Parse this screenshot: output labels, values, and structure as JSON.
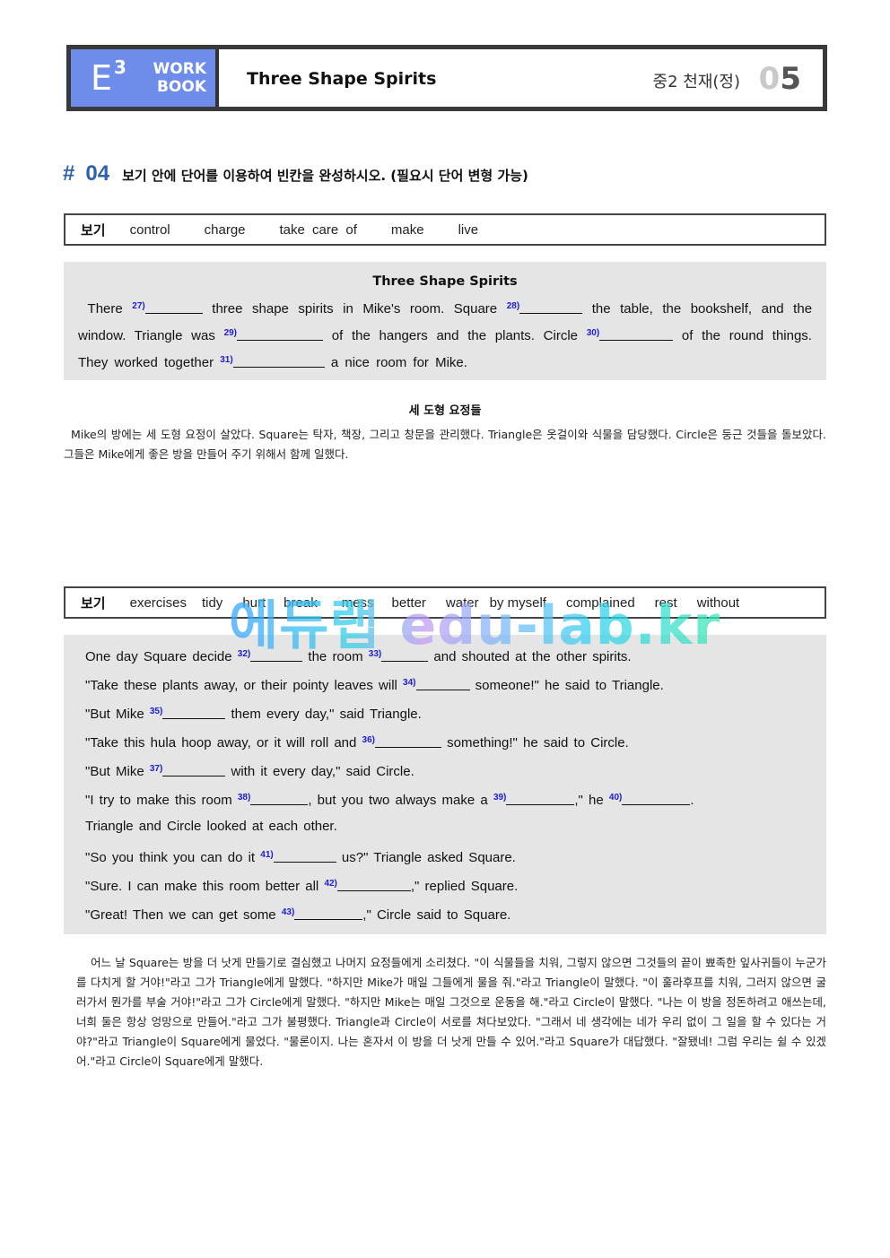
{
  "header": {
    "brand_letter": "E",
    "brand_sup": "3",
    "brand_line1": "WORK",
    "brand_line2": "BOOK",
    "title": "Three Shape Spirits",
    "grade": "중2 천재(정)",
    "unit_prefix": "0",
    "unit_suffix": "5"
  },
  "section": {
    "hash": "#",
    "number": "04",
    "instruction": "보기 안에 단어를 이용하여 빈칸을 완성하시오. (필요시 단어 변형 가능)"
  },
  "wordbox1": {
    "label": "보기",
    "words": [
      "control",
      "charge",
      "take care of",
      "make",
      "live"
    ]
  },
  "passage1": {
    "title": "Three Shape Spirits",
    "segments": {
      "s1": "There",
      "b27": "27)",
      "s2": "three shape spirits in Mike's room. Square",
      "b28": "28)",
      "s3": "the table, the bookshelf, and the window. Triangle was",
      "b29": "29)",
      "s4": "of the hangers and the plants. Circle",
      "b30": "30)",
      "s5": "of the round things. They worked together",
      "b31": "31)",
      "s6": "a nice room for Mike."
    }
  },
  "translation1": {
    "title": "세 도형 요정들",
    "text": "Mike의 방에는 세 도형 요정이 살았다. Square는 탁자, 책장, 그리고 창문을 관리했다. Triangle은 옷걸이와 식물을 담당했다. Circle은 둥근 것들을 돌보았다. 그들은 Mike에게 좋은 방을 만들어 주기 위해서 함께 일했다."
  },
  "wordbox2": {
    "label": "보기",
    "words": [
      "exercises",
      "tidy",
      "hurt",
      "break",
      "mess",
      "better",
      "water",
      "by myself",
      "complained",
      "rest",
      "without"
    ]
  },
  "watermark": "에듀랩 edu-lab.kr",
  "passage2": {
    "lines": [
      {
        "a": "One day Square decide",
        "n1": "32)",
        "b": "the room",
        "n2": "33)",
        "c": "and shouted at the other spirits."
      },
      {
        "a": "\"Take these plants away, or their pointy leaves will",
        "n1": "34)",
        "b": "someone!\" he said to Triangle."
      },
      {
        "a": "\"But Mike",
        "n1": "35)",
        "b": "them every day,\" said Triangle."
      },
      {
        "a": "\"Take this hula hoop away, or it will roll and",
        "n1": "36)",
        "b": "something!\" he said to Circle."
      },
      {
        "a": "\"But Mike",
        "n1": "37)",
        "b": "with it every day,\" said Circle."
      },
      {
        "a": "\"I try to make this room",
        "n1": "38)",
        "b": ", but you two always make a",
        "n2": "39)",
        "c": ",\" he",
        "n3": "40)",
        "d": "."
      },
      {
        "a": "Triangle and Circle looked at each other."
      },
      {
        "a": "\"So you think you can do it",
        "n1": "41)",
        "b": "us?\" Triangle asked Square."
      },
      {
        "a": "\"Sure. I can make this room better all",
        "n1": "42)",
        "b": ",\" replied Square."
      },
      {
        "a": "\"Great! Then we can get some",
        "n1": "43)",
        "b": ",\" Circle said to Square."
      }
    ]
  },
  "translation2": {
    "text": "어느 날 Square는 방을 더 낫게 만들기로 결심했고 나머지 요정들에게 소리쳤다. \"이 식물들을 치워, 그렇지 않으면 그것들의 끝이 뾰족한 잎사귀들이 누군가를 다치게 할 거야!\"라고 그가 Triangle에게 말했다. \"하지만 Mike가 매일 그들에게 물을 줘.\"라고 Triangle이 말했다. \"이 훌라후프를 치워, 그러지 않으면 굴러가서 뭔가를 부술 거야!\"라고 그가 Circle에게 말했다.  \"하지만 Mike는 매일 그것으로 운동을 해.\"라고 Circle이 말했다.  \"나는 이 방을 정돈하려고 애쓰는데, 너희 둘은 항상 엉망으로 만들어.\"라고 그가 불평했다.  Triangle과 Circle이 서로를 쳐다보았다.  \"그래서 네 생각에는 네가 우리 없이 그 일을 할 수 있다는 거야?\"라고 Triangle이 Square에게 물었다. \"물론이지. 나는 혼자서 이 방을 더 낫게 만들 수 있어.\"라고 Square가 대답했다.  \"잘됐네! 그럼 우리는 쉴 수 있겠어.\"라고 Circle이 Square에게 말했다."
  },
  "colors": {
    "brand": "#6e8deb",
    "section_number": "#2e5fb0",
    "blank_number": "#1b1bd6",
    "passage_bg": "#e5e5e5"
  }
}
